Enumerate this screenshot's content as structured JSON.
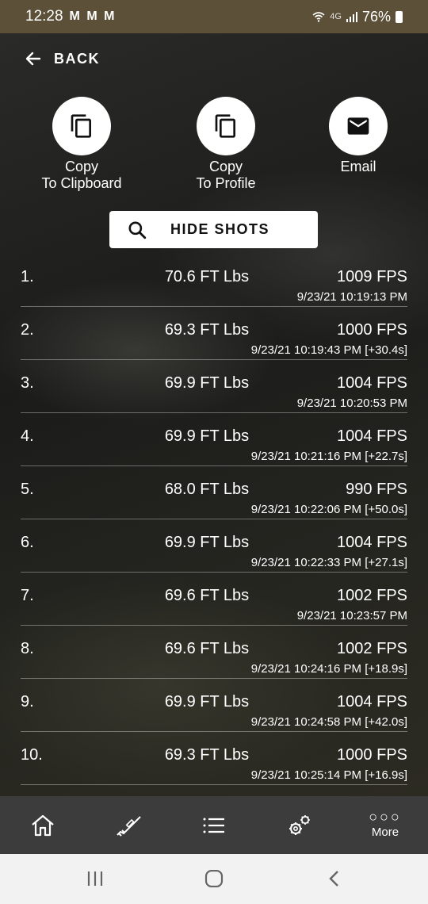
{
  "status": {
    "time": "12:28",
    "notifications": "M M M",
    "network": "4G",
    "battery": "76%"
  },
  "back": {
    "label": "BACK"
  },
  "actions": [
    {
      "label": "Copy\nTo Clipboard",
      "icon": "copy-icon"
    },
    {
      "label": "Copy\nTo Profile",
      "icon": "copy-icon"
    },
    {
      "label": "Email",
      "icon": "mail-icon"
    }
  ],
  "hide_shots": {
    "label": "HIDE SHOTS",
    "icon": "search-icon"
  },
  "shots": [
    {
      "num": "1.",
      "energy": "70.6 FT Lbs",
      "fps": "1009 FPS",
      "ts": "9/23/21 10:19:13 PM"
    },
    {
      "num": "2.",
      "energy": "69.3 FT Lbs",
      "fps": "1000 FPS",
      "ts": "9/23/21 10:19:43 PM [+30.4s]"
    },
    {
      "num": "3.",
      "energy": "69.9 FT Lbs",
      "fps": "1004 FPS",
      "ts": "9/23/21 10:20:53 PM"
    },
    {
      "num": "4.",
      "energy": "69.9 FT Lbs",
      "fps": "1004 FPS",
      "ts": "9/23/21 10:21:16 PM [+22.7s]"
    },
    {
      "num": "5.",
      "energy": "68.0 FT Lbs",
      "fps": "990 FPS",
      "ts": "9/23/21 10:22:06 PM [+50.0s]"
    },
    {
      "num": "6.",
      "energy": "69.9 FT Lbs",
      "fps": "1004 FPS",
      "ts": "9/23/21 10:22:33 PM [+27.1s]"
    },
    {
      "num": "7.",
      "energy": "69.6 FT Lbs",
      "fps": "1002 FPS",
      "ts": "9/23/21 10:23:57 PM"
    },
    {
      "num": "8.",
      "energy": "69.6 FT Lbs",
      "fps": "1002 FPS",
      "ts": "9/23/21 10:24:16 PM [+18.9s]"
    },
    {
      "num": "9.",
      "energy": "69.9 FT Lbs",
      "fps": "1004 FPS",
      "ts": "9/23/21 10:24:58 PM [+42.0s]"
    },
    {
      "num": "10.",
      "energy": "69.3 FT Lbs",
      "fps": "1000 FPS",
      "ts": "9/23/21 10:25:14 PM [+16.9s]"
    }
  ],
  "nav": {
    "items": [
      "home-icon",
      "rifle-icon",
      "list-icon",
      "settings-icon",
      "more-icon"
    ],
    "more_label": "More"
  },
  "system_nav": [
    "recents-icon",
    "home-circle-icon",
    "back-chevron-icon"
  ]
}
